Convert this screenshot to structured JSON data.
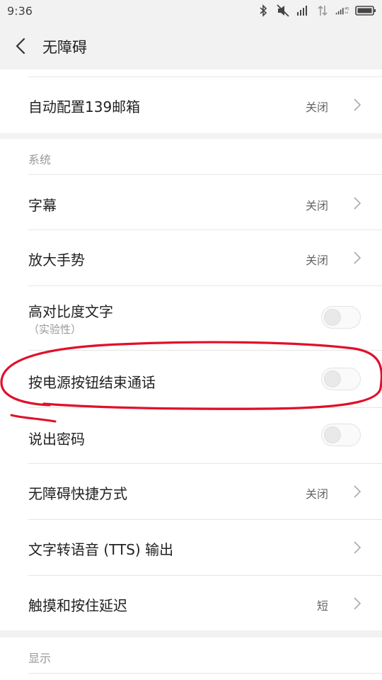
{
  "status_bar": {
    "time": "9:36",
    "icons": [
      "bluetooth-icon",
      "mute-icon",
      "signal-icon",
      "data-arrows-icon",
      "signal-4g-icon",
      "battery-icon"
    ]
  },
  "header": {
    "back_icon": "chevron-left-icon",
    "title": "无障碍"
  },
  "sections": {
    "top_item": {
      "label": "自动配置139邮箱",
      "value": "关闭"
    },
    "system": {
      "header": "系统",
      "items": [
        {
          "label": "字幕",
          "value": "关闭",
          "type": "chevron"
        },
        {
          "label": "放大手势",
          "value": "关闭",
          "type": "chevron"
        },
        {
          "label": "高对比度文字",
          "sublabel": "（实验性）",
          "type": "toggle",
          "state": "off"
        },
        {
          "label": "按电源按钮结束通话",
          "type": "toggle",
          "state": "off"
        },
        {
          "label": "说出密码",
          "type": "toggle",
          "state": "off"
        },
        {
          "label": "无障碍快捷方式",
          "value": "关闭",
          "type": "chevron"
        },
        {
          "label": "文字转语音 (TTS) 输出",
          "type": "chevron"
        },
        {
          "label": "触摸和按住延迟",
          "value": "短",
          "type": "chevron"
        }
      ]
    },
    "display": {
      "header": "显示"
    }
  },
  "annotation": {
    "color": "#e0102a"
  }
}
